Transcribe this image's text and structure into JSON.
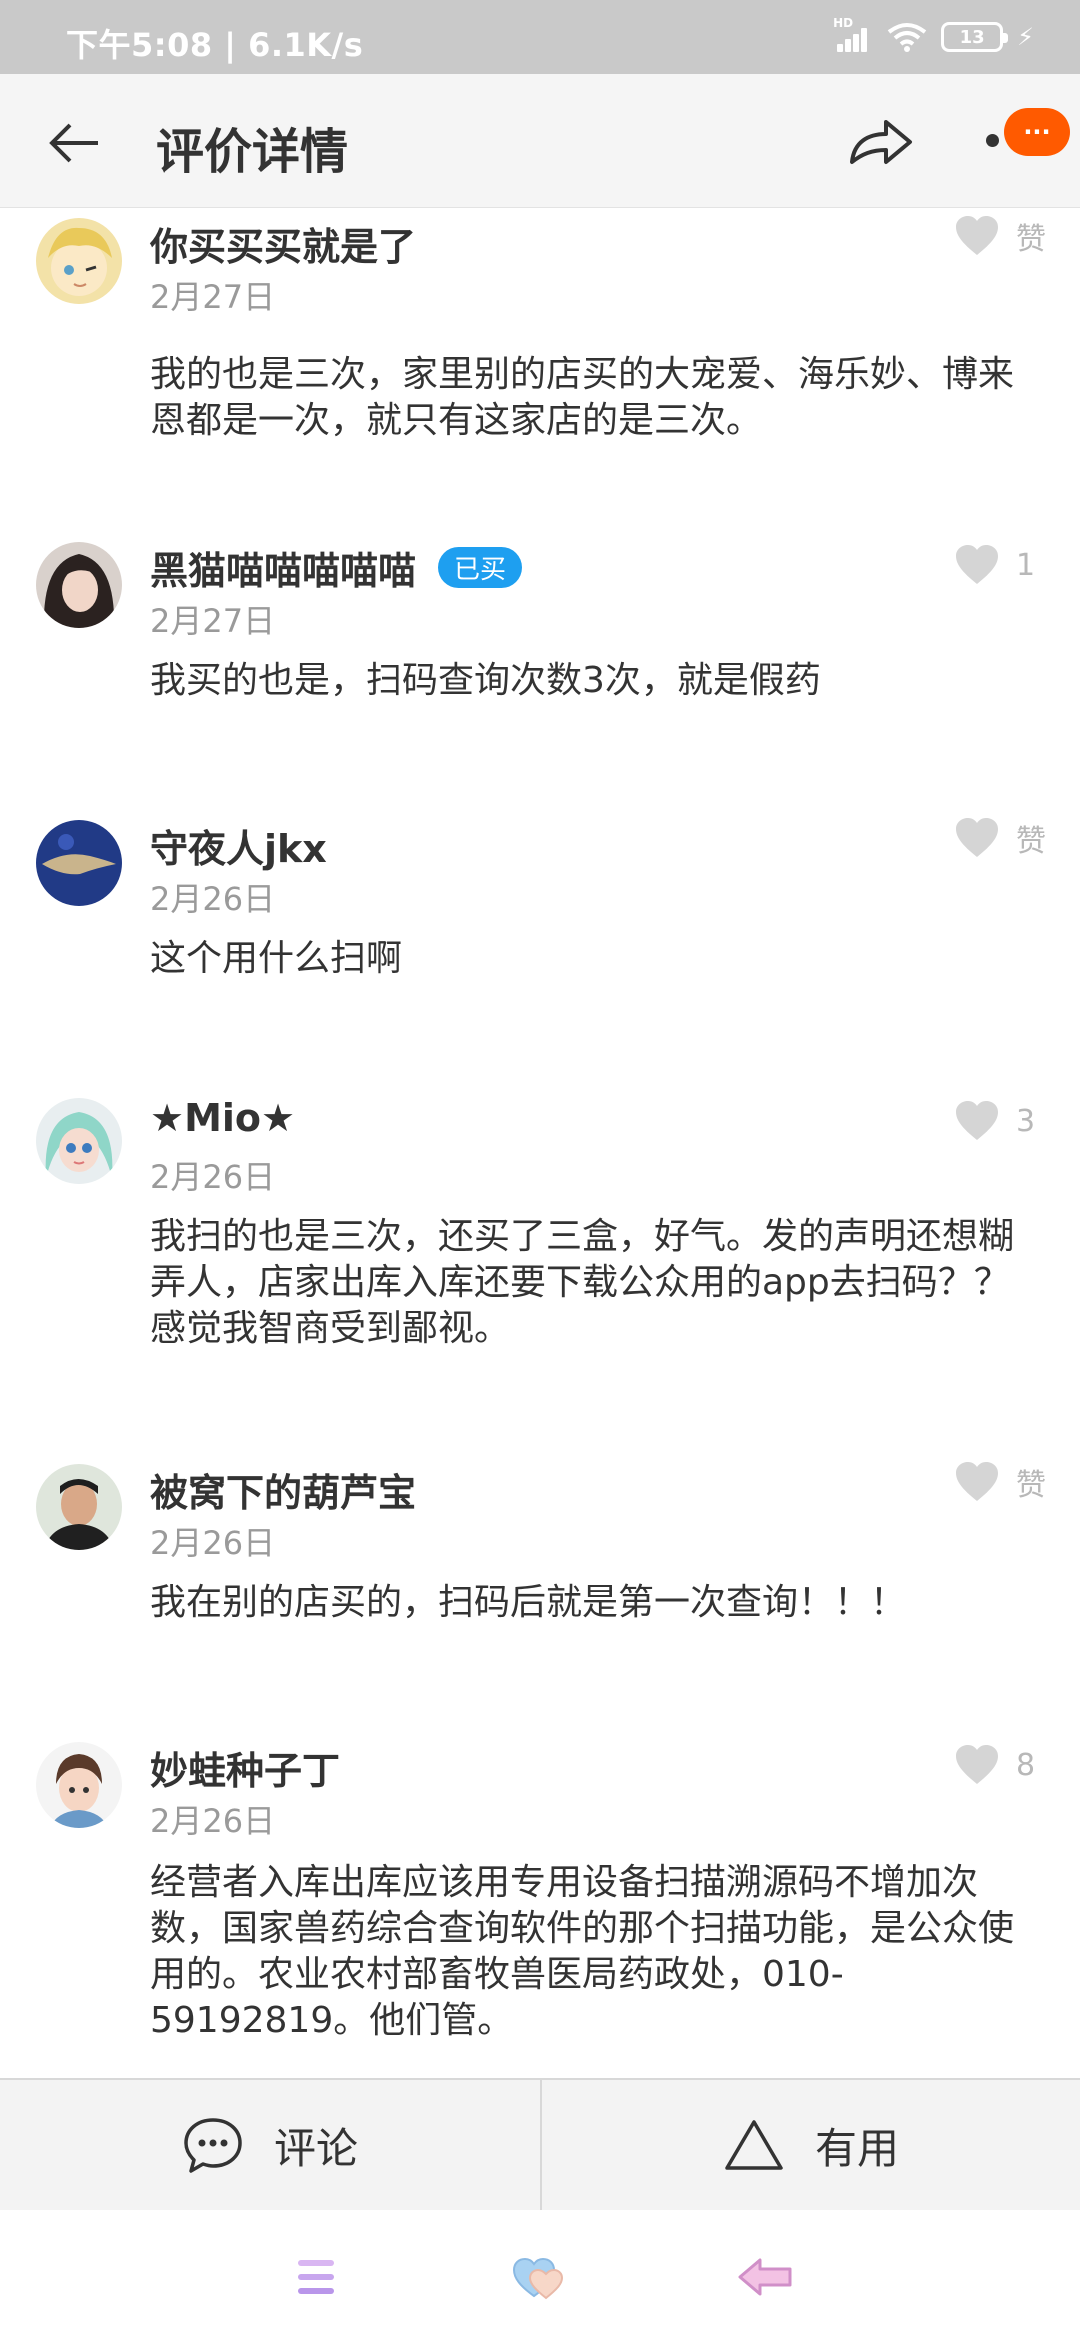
{
  "status_bar": {
    "time_speed": "下午5:08 | 6.1K/s",
    "network_label": "HD",
    "battery": "13"
  },
  "header": {
    "title": "评价详情",
    "more_badge": "···"
  },
  "comments": [
    {
      "name": "你买买买就是了",
      "date": "2月27日",
      "bought": "",
      "likes": "赞",
      "text": "我的也是三次，家里别的店买的大宠爱、海乐妙、博来恩都是一次，就只有这家店的是三次。"
    },
    {
      "name": "黑猫喵喵喵喵喵",
      "date": "2月27日",
      "bought": "已买",
      "likes": "1",
      "text": "我买的也是，扫码查询次数3次，就是假药"
    },
    {
      "name": "守夜人jkx",
      "date": "2月26日",
      "bought": "",
      "likes": "赞",
      "text": "这个用什么扫啊"
    },
    {
      "name": "★Mio★",
      "date": "2月26日",
      "bought": "",
      "likes": "3",
      "text": "我扫的也是三次，还买了三盒，好气。发的声明还想糊弄人，店家出库入库还要下载公众用的app去扫码？？感觉我智商受到鄙视。"
    },
    {
      "name": "被窝下的葫芦宝",
      "date": "2月26日",
      "bought": "",
      "likes": "赞",
      "text": "我在别的店买的，扫码后就是第一次查询！！！"
    },
    {
      "name": "妙蛙种子丁",
      "date": "2月26日",
      "bought": "",
      "likes": "8",
      "text": "经营者入库出库应该用专用设备扫描溯源码不增加次数，国家兽药综合查询软件的那个扫描功能，是公众使用的。农业农村部畜牧兽医局药政处，010-59192819。他们管。"
    }
  ],
  "action_bar": {
    "comment_label": "评论",
    "useful_label": "有用"
  },
  "colors": {
    "accent_orange": "#ff5a00",
    "bought_badge": "#1e9ff0",
    "like_gray": "#d5d5d5"
  }
}
